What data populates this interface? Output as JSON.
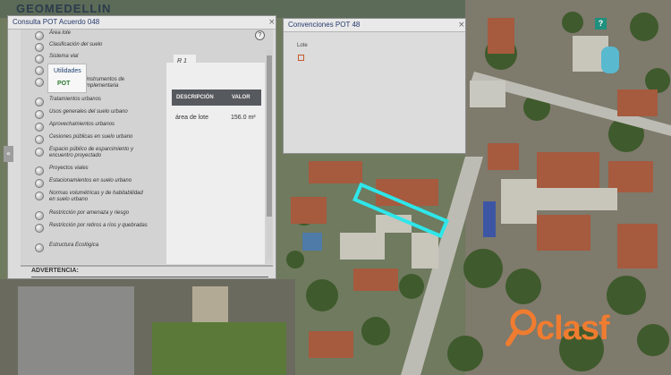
{
  "app": {
    "brand": "GEOMEDELLIN"
  },
  "colors": {
    "accent_teal": "#1f8f7e",
    "highlight_cyan": "#2ee6ea",
    "watermark_orange": "#f07c30",
    "lote_outline": "#c9572a"
  },
  "left_panel": {
    "title": "Consulta POT Acuerdo 048",
    "close_icon": "×",
    "help_glyph": "?",
    "side_tab_glyph": "«",
    "layers": [
      "Área lote",
      "Clasificación del suelo",
      "Sistema vial",
      "Tratamientos",
      "Subsistema de instrumentos de planificación complementaria",
      "Tratamientos urbanos",
      "Usos generales del suelo urbano",
      "Aprovechamientos urbanos",
      "Cesiones públicas en suelo urbano",
      "Espacio público de esparcimiento y encuentro proyectado",
      "Proyectos viales",
      "Estacionamientos en suelo urbano",
      "Normas volumétricas y de habitabilidad en suelo urbano",
      "Restricción por amenaza y riesgo",
      "Restricción por retiros a ríos y quebradas",
      "Estructura Ecológica"
    ],
    "result": {
      "tab_label": "R 1",
      "columns": [
        "DESCRIPCIÓN",
        "VALOR"
      ],
      "rows": [
        {
          "descripcion": "área de lote",
          "valor": "156.0 m²"
        }
      ]
    },
    "advertencia": "ADVERTENCIA:"
  },
  "menu": {
    "items": [
      "Utilidades",
      "POT"
    ]
  },
  "right_panel": {
    "title": "Convenciones POT 48",
    "close_icon": "×",
    "legend_item": "Lote"
  },
  "map": {
    "help_glyph": "?"
  },
  "watermark": {
    "text": "clasf"
  }
}
